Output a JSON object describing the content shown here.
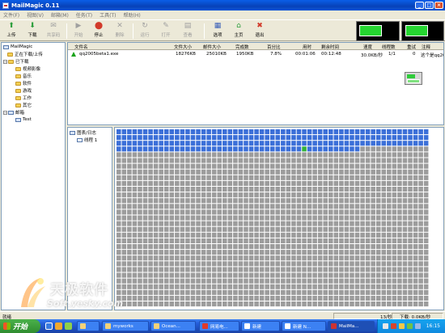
{
  "window": {
    "title": "MailMagic 0.11"
  },
  "menu": [
    "文件(F)",
    "视图(V)",
    "邮箱(M)",
    "任务(T)",
    "工具(T)",
    "帮助(H)"
  ],
  "toolbar": {
    "buttons": [
      {
        "label": "上传",
        "icon": "upload-icon",
        "enabled": true
      },
      {
        "label": "下载",
        "icon": "download-icon",
        "enabled": true
      },
      {
        "label": "共享码",
        "icon": "share-code-icon",
        "enabled": false
      },
      {
        "label": "开始",
        "icon": "play-icon",
        "enabled": false
      },
      {
        "label": "停止",
        "icon": "stop-icon",
        "enabled": true
      },
      {
        "label": "删除",
        "icon": "delete-icon",
        "enabled": false
      },
      {
        "label": "运行",
        "icon": "run-icon",
        "enabled": false
      },
      {
        "label": "打开",
        "icon": "open-icon",
        "enabled": false
      },
      {
        "label": "查看",
        "icon": "view-icon",
        "enabled": false
      },
      {
        "label": "选项",
        "icon": "options-icon",
        "enabled": true
      },
      {
        "label": "主页",
        "icon": "home-icon",
        "enabled": true
      },
      {
        "label": "退出",
        "icon": "exit-icon",
        "enabled": true
      }
    ]
  },
  "tree": {
    "root": "MailMagic",
    "items": [
      {
        "label": "正在下载/上传",
        "level": 1
      },
      {
        "label": "已下载",
        "level": 1
      },
      {
        "label": "视频影像",
        "level": 2
      },
      {
        "label": "音乐",
        "level": 2
      },
      {
        "label": "软件",
        "level": 2
      },
      {
        "label": "游戏",
        "level": 2
      },
      {
        "label": "工作",
        "level": 2
      },
      {
        "label": "其它",
        "level": 2
      },
      {
        "label": "邮箱",
        "level": 1
      },
      {
        "label": "Test",
        "level": 2
      }
    ]
  },
  "tasks": {
    "columns": [
      "文件名",
      "文件大小",
      "邮件大小",
      "完成数",
      "百分比",
      "用时",
      "剩余时间",
      "速度",
      "线程数",
      "重试",
      "注释"
    ],
    "rows": [
      [
        "qq2005beta1.exe",
        "18276KB",
        "25010KB",
        "1950KB",
        "7.8%",
        "00:01:06",
        "00:12:48",
        "30.0KB/秒",
        "1/1",
        "0",
        "这个是qq20"
      ]
    ]
  },
  "chart_tree": {
    "root": "图表/日志",
    "child": "线程 1"
  },
  "blockmap": {
    "columns": 59,
    "rows": 31,
    "done_blocks": 223,
    "active_block": 212,
    "colors": {
      "done": "#3b6fd8",
      "active": "#33b33a",
      "pending": "#9c9c9c"
    }
  },
  "statusbar": {
    "left": "就绪",
    "speed": "13/秒",
    "download": "下载: 0.0KB/秒"
  },
  "watermark": {
    "text": "天极软件",
    "sub": "Soft.yesky.com"
  },
  "taskbar": {
    "start": "开始",
    "buttons": [
      "",
      "myworks",
      "Ocean...",
      "网易电...",
      "新建",
      "新建 N...",
      "MailMa..."
    ],
    "clock": "16:15"
  }
}
